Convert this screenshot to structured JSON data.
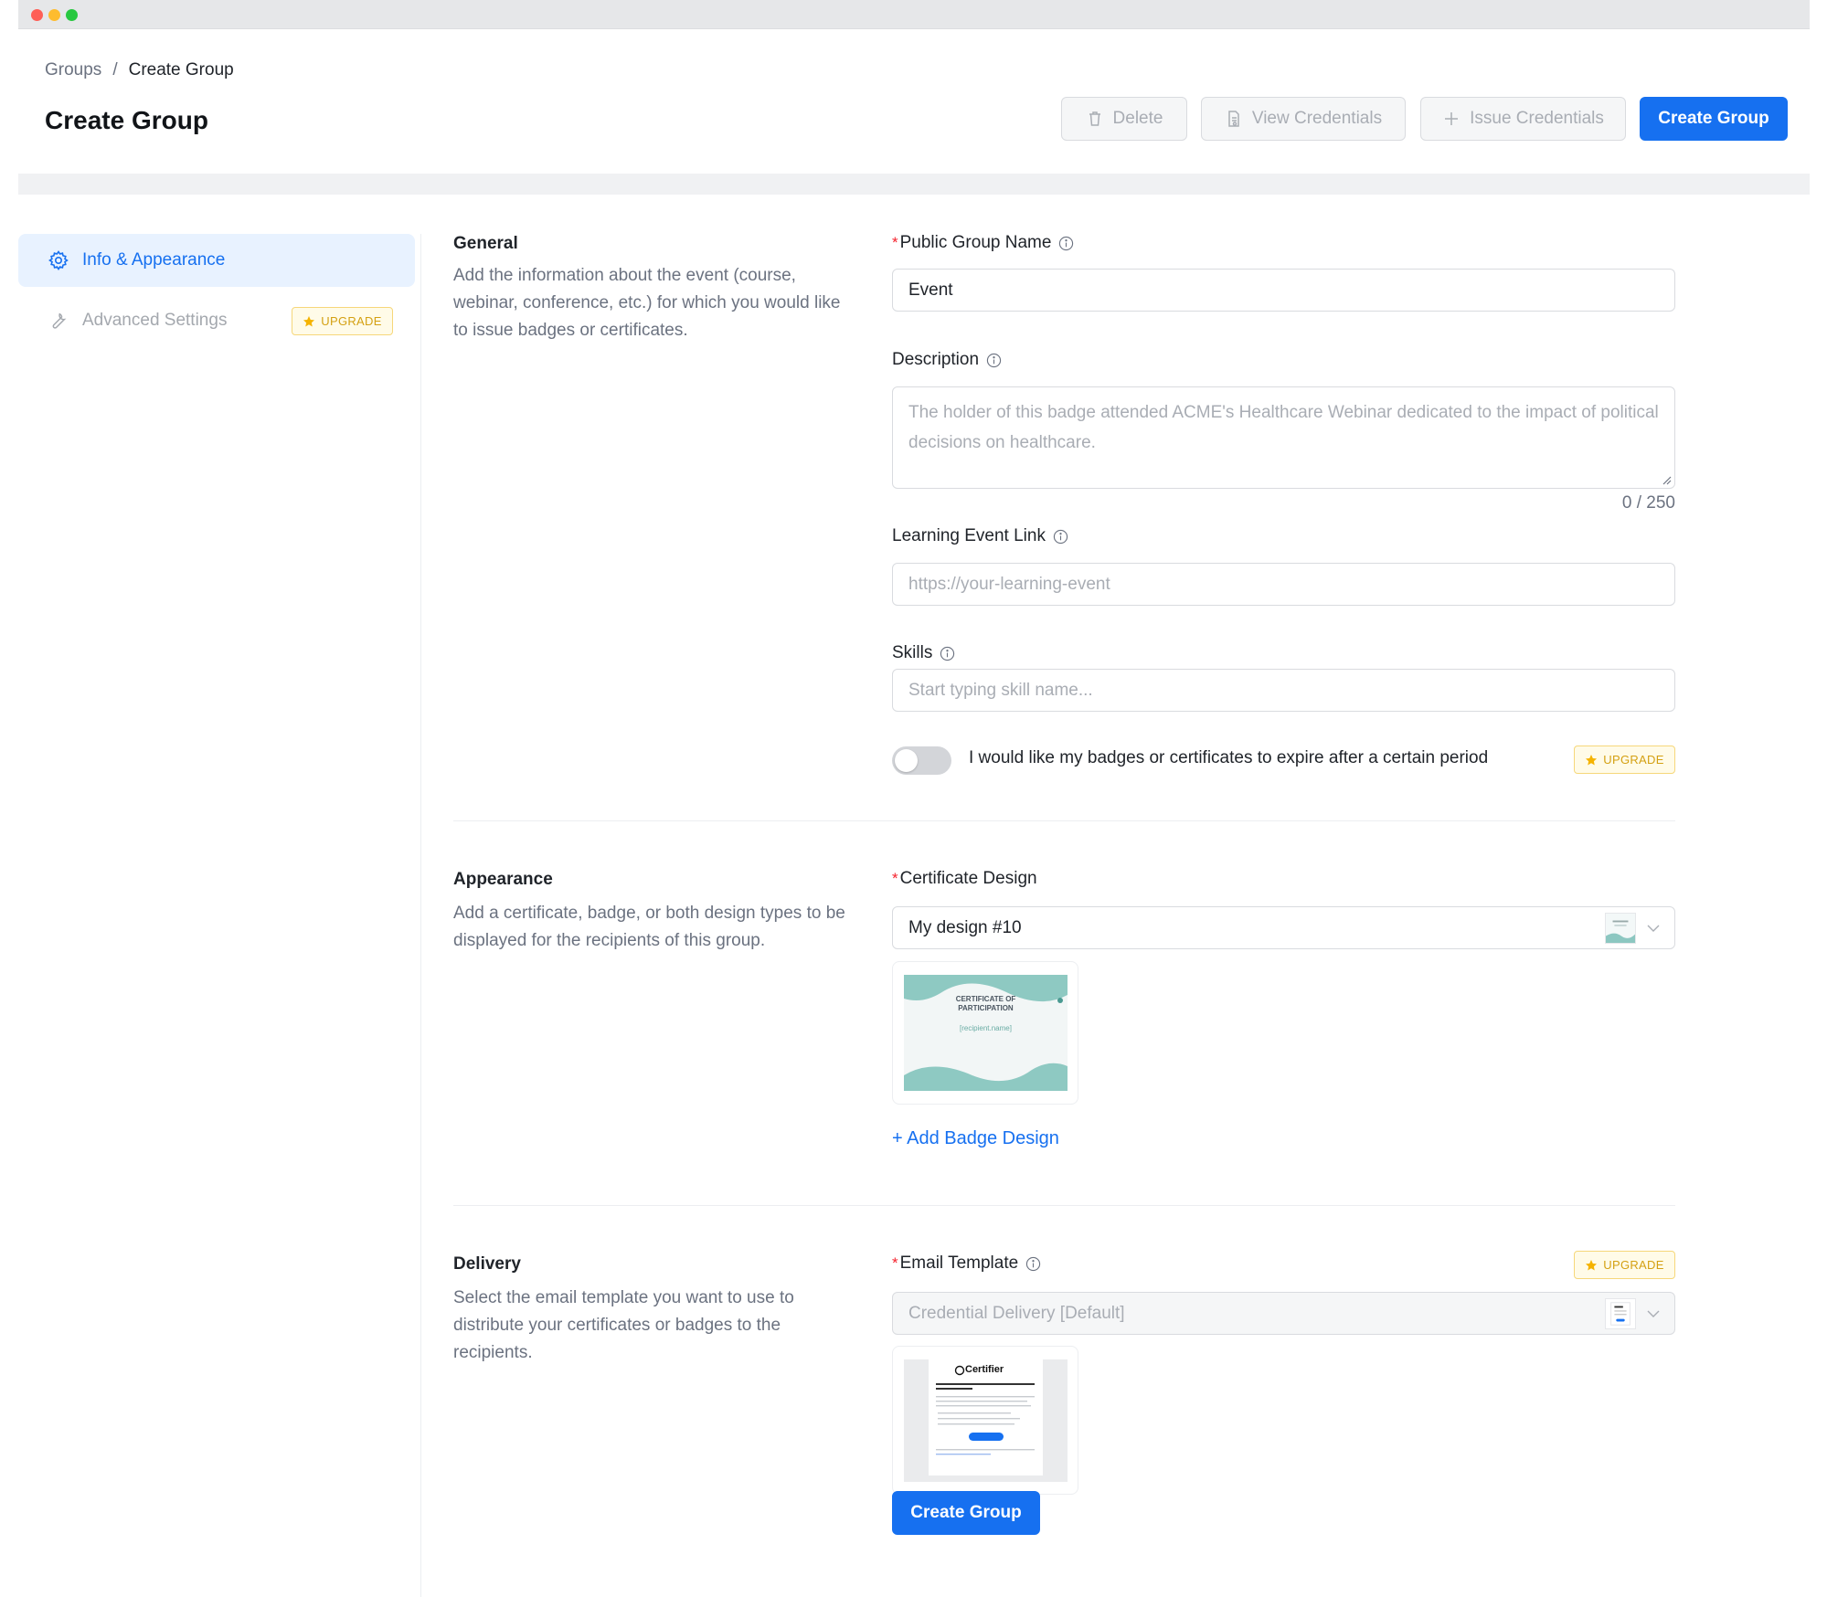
{
  "breadcrumb": {
    "parent": "Groups",
    "separator": "/",
    "current": "Create Group"
  },
  "page": {
    "title": "Create Group"
  },
  "header_actions": {
    "delete": "Delete",
    "view_credentials": "View Credentials",
    "issue_credentials": "Issue Credentials",
    "create_group": "Create Group"
  },
  "sidebar": {
    "items": [
      {
        "label": "Info & Appearance",
        "icon": "gear-icon",
        "active": true
      },
      {
        "label": "Advanced Settings",
        "icon": "wrench-icon",
        "active": false,
        "badge": "UPGRADE"
      }
    ]
  },
  "general": {
    "title": "General",
    "description": "Add the information about the event (course, webinar, conference, etc.) for which you would like to issue badges or certificates.",
    "public_group_name": {
      "label": "Public Group Name",
      "value": "Event"
    },
    "description_field": {
      "label": "Description",
      "placeholder": "The holder of this badge attended ACME's Healthcare Webinar dedicated to the impact of political decisions on healthcare.",
      "counter": "0 / 250"
    },
    "learning_event_link": {
      "label": "Learning Event Link",
      "placeholder": "https://your-learning-event"
    },
    "skills": {
      "label": "Skills",
      "placeholder": "Start typing skill name..."
    },
    "expire_toggle": {
      "label": "I would like my badges or certificates to expire after a certain period",
      "enabled": false,
      "badge": "UPGRADE"
    }
  },
  "appearance": {
    "title": "Appearance",
    "description": "Add a certificate, badge, or both design types to be displayed for the recipients of this group.",
    "certificate_design": {
      "label": "Certificate Design",
      "value": "My design #10"
    },
    "preview": {
      "heading": "CERTIFICATE OF PARTICIPATION",
      "recipient": "[recipient.name]"
    },
    "add_badge": "+ Add Badge Design"
  },
  "delivery": {
    "title": "Delivery",
    "description": "Select the email template you want to use to distribute your certificates or badges to the recipients.",
    "email_template": {
      "label": "Email Template",
      "value": "Credential Delivery [Default]",
      "badge": "UPGRADE"
    },
    "preview": {
      "brand": "Certifier"
    },
    "submit": "Create Group"
  },
  "colors": {
    "primary": "#1670f0",
    "upgrade": "#d4a012",
    "required": "#f5222d"
  }
}
